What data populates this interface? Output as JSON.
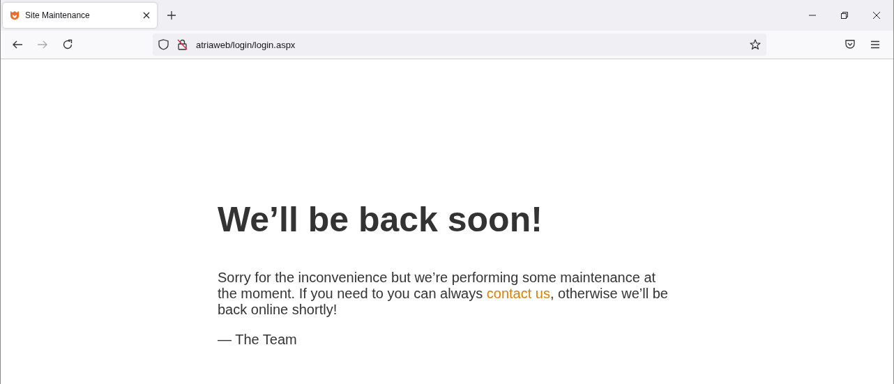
{
  "tabs": [
    {
      "title": "Site Maintenance",
      "selected": true
    }
  ],
  "nav": {
    "back_disabled": false,
    "forward_disabled": true
  },
  "address_bar": {
    "url": "atriaweb/login/login.aspx"
  },
  "page": {
    "heading": "We’ll be back soon!",
    "message": {
      "before": "Sorry for the inconvenience but we’re performing some maintenance at the moment. If you need to you can always ",
      "link": "contact us",
      "after": ", otherwise we’ll be back online shortly!"
    },
    "signature": "— The Team"
  }
}
